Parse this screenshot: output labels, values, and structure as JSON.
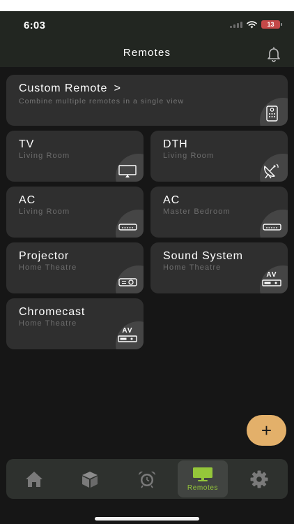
{
  "status_bar": {
    "time": "6:03",
    "battery": "13"
  },
  "header": {
    "title": "Remotes"
  },
  "custom_remote": {
    "title": "Custom Remote",
    "chevron": ">",
    "subtitle": "Combine multiple remotes in a single view",
    "icon": "remote-control-icon"
  },
  "remotes": [
    {
      "name": "TV",
      "room": "Living Room",
      "icon": "tv-icon"
    },
    {
      "name": "DTH",
      "room": "Living Room",
      "icon": "satellite-dish-icon"
    },
    {
      "name": "AC",
      "room": "Living Room",
      "icon": "air-conditioner-icon"
    },
    {
      "name": "AC",
      "room": "Master Bedroom",
      "icon": "air-conditioner-icon"
    },
    {
      "name": "Projector",
      "room": "Home Theatre",
      "icon": "projector-icon"
    },
    {
      "name": "Sound System",
      "room": "Home Theatre",
      "icon": "av-receiver-icon"
    },
    {
      "name": "Chromecast",
      "room": "Home Theatre",
      "icon": "av-receiver-icon"
    }
  ],
  "av_badge": "AV",
  "add_button": {
    "glyph": "+"
  },
  "tab_bar": {
    "active_label": "Remotes",
    "tabs": [
      "home-icon",
      "cube-icon",
      "alarm-clock-icon",
      "monitor-icon",
      "gear-icon"
    ]
  },
  "colors": {
    "background": "#161616",
    "card": "#2f2f2f",
    "accent_green": "#94c63a",
    "fab": "#e3b06a",
    "battery_low": "#c44848"
  }
}
